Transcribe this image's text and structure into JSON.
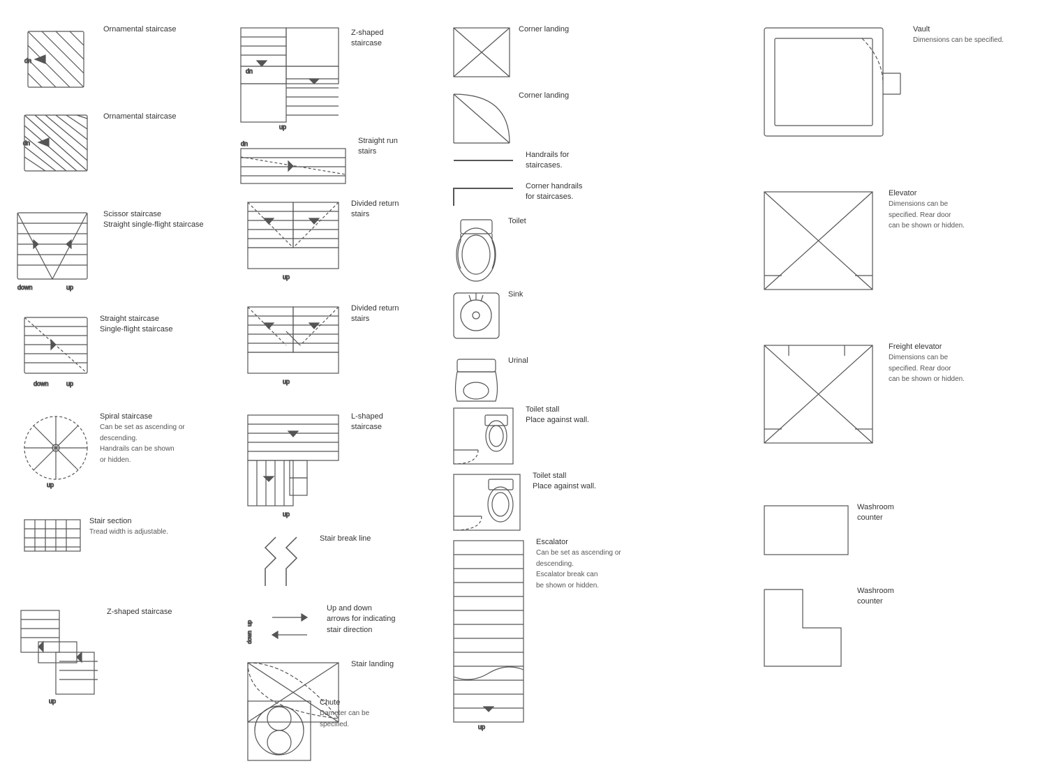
{
  "items": {
    "ornamental1": {
      "label": "Ornamental staircase"
    },
    "ornamental2": {
      "label": "Ornamental staircase"
    },
    "scissor": {
      "label": "Scissor staircase",
      "sublabel": "Straight single-flight staircase"
    },
    "straight": {
      "label": "Straight staircase",
      "sublabel": "Single-flight staircase"
    },
    "spiral": {
      "label": "Spiral staircase",
      "desc1": "Can be set as ascending or",
      "desc2": "descending.",
      "desc3": "Handrails can be shown",
      "desc4": "or hidden."
    },
    "stairSection": {
      "label": "Stair section",
      "desc": "Tread width is adjustable."
    },
    "zShaped": {
      "label": "Z-shaped staircase"
    },
    "zShapedTop": {
      "label": "Z-shaped",
      "sublabel": "staircase"
    },
    "straightRun": {
      "label": "Straight run",
      "sublabel": "stairs"
    },
    "dividedReturn1": {
      "label": "Divided return",
      "sublabel": "stairs"
    },
    "dividedReturn2": {
      "label": "Divided return",
      "sublabel": "stairs"
    },
    "lShaped": {
      "label": "L-shaped",
      "sublabel": "staircase"
    },
    "stairBreak": {
      "label": "Stair break line"
    },
    "upDownArrows": {
      "label": "Up and down",
      "desc1": "arrows for indicating",
      "desc2": "stair direction"
    },
    "stairLanding": {
      "label": "Stair landing"
    },
    "chute": {
      "label": "Chute",
      "desc": "Dameter can be",
      "desc2": "specified."
    },
    "cornerLanding1": {
      "label": "Corner landing"
    },
    "cornerLanding2": {
      "label": "Corner landing"
    },
    "handrails": {
      "label": "Handrails for",
      "sublabel": "staircases."
    },
    "cornerHandrails": {
      "label": "Corner handrails",
      "sublabel": "for staircases."
    },
    "toilet": {
      "label": "Toilet"
    },
    "sink": {
      "label": "Sink"
    },
    "urinal": {
      "label": "Urinal"
    },
    "toiletStall1": {
      "label": "Toilet stall",
      "desc": "Place against wall."
    },
    "toiletStall2": {
      "label": "Toilet stall",
      "desc": "Place against wall."
    },
    "escalator": {
      "label": "Escalator",
      "desc1": "Can be set as ascending or",
      "desc2": "descending.",
      "desc3": "Escalator break can",
      "desc4": "be shown or hidden."
    },
    "vault": {
      "label": "Vault",
      "desc": "Dimensions can be specified."
    },
    "elevator": {
      "label": "Elevator",
      "desc1": "Dimensions can be",
      "desc2": "specified. Rear door",
      "desc3": "can be shown or hidden."
    },
    "freightElevator": {
      "label": "Freight elevator",
      "desc1": "Dimensions can be",
      "desc2": "specified. Rear door",
      "desc3": "can be shown or hidden."
    },
    "washroomCounter1": {
      "label": "Washroom",
      "sublabel": "counter"
    },
    "washroomCounter2": {
      "label": "Washroom",
      "sublabel": "counter"
    }
  }
}
